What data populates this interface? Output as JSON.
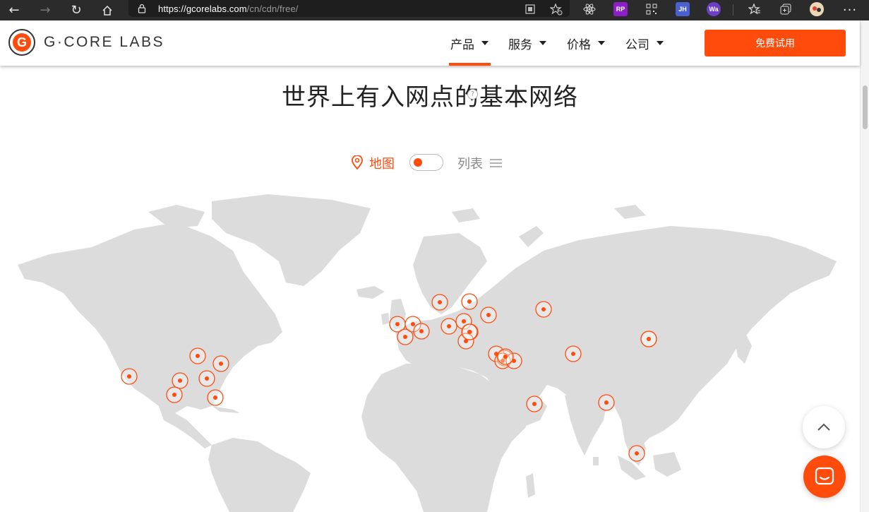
{
  "browser": {
    "url_host": "https://gcorelabs.com",
    "url_path": "/cn/cdn/free/",
    "extensions": [
      "qr-reader-icon",
      "favorites-add-icon",
      "react-devtools-icon",
      "rp",
      "qr-code-icon",
      "jh",
      "wappalyzer-icon",
      "favorites-icon",
      "collections-icon",
      "profile-avatar",
      "more-icon"
    ],
    "ext_rp": "RP",
    "ext_jh": "JH",
    "ext_wa": "Wa"
  },
  "header": {
    "brand": "G·CORE LABS",
    "logo_letter": "G",
    "menu": [
      {
        "label": "产品",
        "active": true
      },
      {
        "label": "服务",
        "active": false
      },
      {
        "label": "价格",
        "active": false
      },
      {
        "label": "公司",
        "active": false
      }
    ],
    "cta": "免费试用"
  },
  "main": {
    "heading": "世界上有入网点的基本网络",
    "help_glyph": "?",
    "toggle": {
      "map_label": "地图",
      "list_label": "列表",
      "selected": "map"
    }
  },
  "colors": {
    "accent": "#ff4c0d",
    "land": "#dcdcdc",
    "chrome": "#2b2b2b"
  },
  "map": {
    "locations": [
      {
        "name": "los-angeles"
      },
      {
        "name": "dallas"
      },
      {
        "name": "houston"
      },
      {
        "name": "chicago"
      },
      {
        "name": "atlanta"
      },
      {
        "name": "ashburn"
      },
      {
        "name": "miami"
      },
      {
        "name": "london"
      },
      {
        "name": "paris"
      },
      {
        "name": "amsterdam"
      },
      {
        "name": "frankfurt"
      },
      {
        "name": "stockholm"
      },
      {
        "name": "riga"
      },
      {
        "name": "warsaw"
      },
      {
        "name": "vienna"
      },
      {
        "name": "budapest"
      },
      {
        "name": "sofia"
      },
      {
        "name": "moscow"
      },
      {
        "name": "kyiv"
      },
      {
        "name": "istanbul"
      },
      {
        "name": "tbilisi"
      },
      {
        "name": "yerevan"
      },
      {
        "name": "baku"
      },
      {
        "name": "dubai"
      },
      {
        "name": "almaty"
      },
      {
        "name": "novosibirsk"
      },
      {
        "name": "khabarovsk"
      },
      {
        "name": "mumbai"
      },
      {
        "name": "singapore"
      },
      {
        "name": "tashkent"
      },
      {
        "name": "chisinau"
      }
    ]
  }
}
